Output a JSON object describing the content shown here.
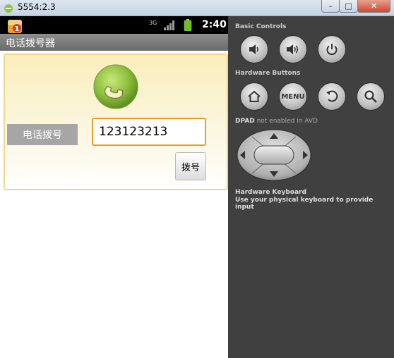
{
  "window": {
    "title": "5554:2.3",
    "minimize": "–",
    "maximize": "□",
    "close": "✕"
  },
  "status_bar": {
    "notification_badge": "1",
    "network": "3G",
    "time": "2:40"
  },
  "app": {
    "title": "电话拨号器",
    "dial_label": "电话拨号",
    "phone_number": "123123213",
    "dial_button": "拨号"
  },
  "controls": {
    "basic_controls_title": "Basic Controls",
    "hardware_buttons_title": "Hardware Buttons",
    "menu_label": "MENU",
    "dpad_title": "DPAD",
    "dpad_note": "not enabled in AVD",
    "keyboard_title": "Hardware Keyboard",
    "keyboard_note": "Use your physical keyboard to provide input"
  },
  "icons": {
    "call": "phone-call-icon",
    "volume_down": "volume-down-icon",
    "volume_up": "volume-up-icon",
    "power": "power-icon",
    "home": "home-icon",
    "back": "back-icon",
    "search": "search-icon"
  },
  "colors": {
    "input_focus_border": "#f09a25",
    "call_green": "#8dbf3d",
    "panel_bg": "#404040"
  }
}
